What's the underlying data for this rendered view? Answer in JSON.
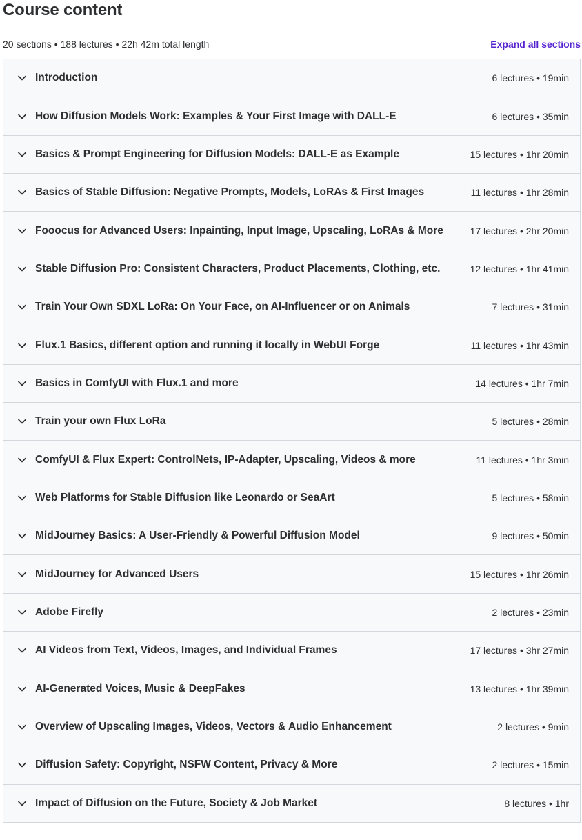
{
  "header": {
    "title": "Course content",
    "summary": "20 sections • 188 lectures • 22h 42m total length",
    "expand_label": "Expand all sections"
  },
  "colors": {
    "accent": "#5624d0",
    "row_background": "#f7f9fa",
    "border": "#d1d7dc",
    "text": "#2d2f31"
  },
  "sections": [
    {
      "title": "Introduction",
      "meta": "6 lectures • 19min"
    },
    {
      "title": "How Diffusion Models Work: Examples & Your First Image with DALL-E",
      "meta": "6 lectures • 35min"
    },
    {
      "title": "Basics & Prompt Engineering for Diffusion Models: DALL-E as Example",
      "meta": "15 lectures • 1hr 20min"
    },
    {
      "title": "Basics of Stable Diffusion: Negative Prompts, Models, LoRAs & First Images",
      "meta": "11 lectures • 1hr 28min"
    },
    {
      "title": "Fooocus for Advanced Users: Inpainting, Input Image, Upscaling, LoRAs & More",
      "meta": "17 lectures • 2hr 20min"
    },
    {
      "title": "Stable Diffusion Pro: Consistent Characters, Product Placements, Clothing, etc.",
      "meta": "12 lectures • 1hr 41min"
    },
    {
      "title": "Train Your Own SDXL LoRa: On Your Face, on AI-Influencer or on Animals",
      "meta": "7 lectures • 31min"
    },
    {
      "title": "Flux.1 Basics, different option and running it locally in WebUI Forge",
      "meta": "11 lectures • 1hr 43min"
    },
    {
      "title": "Basics in ComfyUI with Flux.1 and more",
      "meta": "14 lectures • 1hr 7min"
    },
    {
      "title": "Train your own Flux LoRa",
      "meta": "5 lectures • 28min"
    },
    {
      "title": "ComfyUI & Flux Expert: ControlNets, IP-Adapter, Upscaling, Videos & more",
      "meta": "11 lectures • 1hr 3min"
    },
    {
      "title": "Web Platforms for Stable Diffusion like Leonardo or SeaArt",
      "meta": "5 lectures • 58min"
    },
    {
      "title": "MidJourney Basics: A User-Friendly & Powerful Diffusion Model",
      "meta": "9 lectures • 50min"
    },
    {
      "title": "MidJourney for Advanced Users",
      "meta": "15 lectures • 1hr 26min"
    },
    {
      "title": "Adobe Firefly",
      "meta": "2 lectures • 23min"
    },
    {
      "title": "AI Videos from Text, Videos, Images, and Individual Frames",
      "meta": "17 lectures • 3hr 27min"
    },
    {
      "title": "AI-Generated Voices, Music & DeepFakes",
      "meta": "13 lectures • 1hr 39min"
    },
    {
      "title": "Overview of Upscaling Images, Videos, Vectors & Audio Enhancement",
      "meta": "2 lectures • 9min"
    },
    {
      "title": "Diffusion Safety: Copyright, NSFW Content, Privacy & More",
      "meta": "2 lectures • 15min"
    },
    {
      "title": "Impact of Diffusion on the Future, Society & Job Market",
      "meta": "8 lectures • 1hr"
    }
  ]
}
